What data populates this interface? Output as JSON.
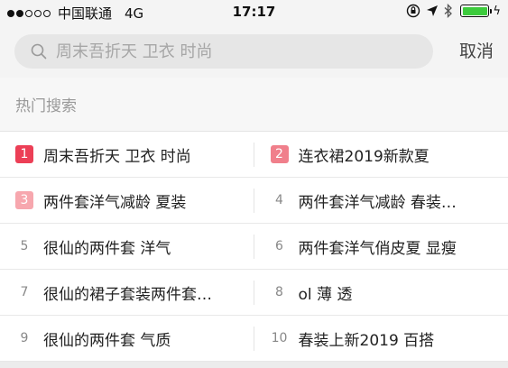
{
  "status_bar": {
    "carrier": "中国联通",
    "network": "4G",
    "time": "17:17",
    "bolt": "ϟ"
  },
  "search": {
    "placeholder": "周末吾折天 卫衣 时尚",
    "cancel_label": "取消"
  },
  "section": {
    "title": "热门搜索"
  },
  "hot_items": [
    {
      "rank": "1",
      "text": "周末吾折天 卫衣 时尚"
    },
    {
      "rank": "2",
      "text": "连衣裙2019新款夏"
    },
    {
      "rank": "3",
      "text": "两件套洋气减龄 夏装"
    },
    {
      "rank": "4",
      "text": "两件套洋气减龄 春装…"
    },
    {
      "rank": "5",
      "text": "很仙的两件套 洋气"
    },
    {
      "rank": "6",
      "text": "两件套洋气俏皮夏 显瘦"
    },
    {
      "rank": "7",
      "text": "很仙的裙子套装两件套…"
    },
    {
      "rank": "8",
      "text": "ol 薄 透"
    },
    {
      "rank": "9",
      "text": "很仙的两件套 气质"
    },
    {
      "rank": "10",
      "text": "春装上新2019 百搭"
    }
  ],
  "colors": {
    "rank1": "#ec3f56",
    "rank2": "#f07f8b",
    "rank3": "#f7a7ae",
    "battery": "#3ccb3c"
  },
  "icons": [
    "search-icon",
    "orientation-lock-icon",
    "location-arrow-icon",
    "bluetooth-icon",
    "battery-icon",
    "charging-bolt-icon"
  ]
}
